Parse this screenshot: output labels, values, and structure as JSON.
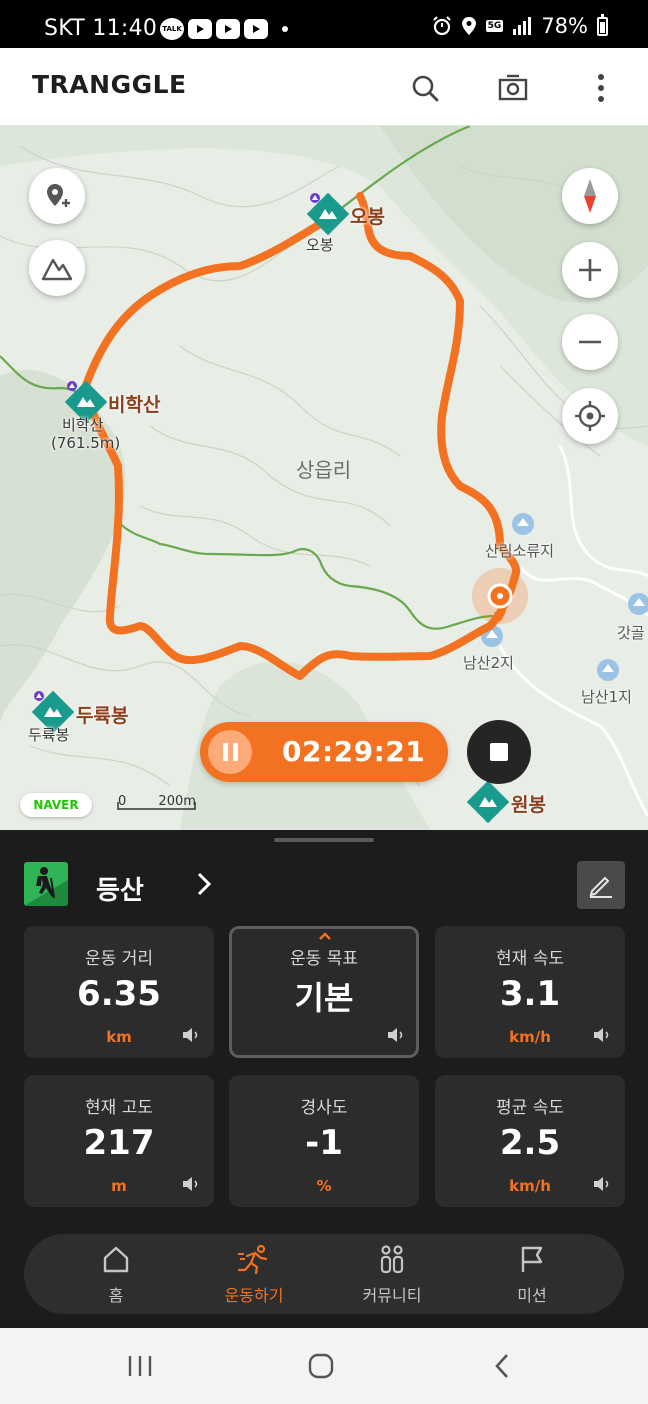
{
  "status_bar": {
    "carrier_time": "SKT 11:40",
    "talk_badge": "TALK",
    "network": "5G",
    "battery": "78%"
  },
  "app": {
    "logo": "TRANGGLE",
    "icons": [
      "search-icon",
      "camera-icon",
      "more-vertical-icon"
    ]
  },
  "map": {
    "peaks": [
      {
        "name": "오봉",
        "sub": "오봉"
      },
      {
        "name": "비학산",
        "sub_line1": "비학산",
        "sub_line2": "(761.5m)"
      },
      {
        "name": "두륙봉",
        "sub": "두륙봉"
      },
      {
        "name": "원봉"
      }
    ],
    "area_label": "상읍리",
    "places": [
      "산림소류지",
      "남산2지",
      "남산1지",
      "갓골"
    ],
    "attribution": "NAVER",
    "scale_zero": "0",
    "scale_distance": "200m",
    "controls": [
      "add-location-icon",
      "mountain-icon",
      "compass-icon",
      "zoom-in-icon",
      "zoom-out-icon",
      "my-location-icon"
    ]
  },
  "recording": {
    "elapsed": "02:29:21"
  },
  "activity": {
    "type": "등산"
  },
  "stats": [
    {
      "label": "운동 거리",
      "value": "6.35",
      "unit": "km"
    },
    {
      "label": "운동 목표",
      "value": "기본",
      "unit": ""
    },
    {
      "label": "현재 속도",
      "value": "3.1",
      "unit": "km/h"
    },
    {
      "label": "현재 고도",
      "value": "217",
      "unit": "m"
    },
    {
      "label": "경사도",
      "value": "-1",
      "unit": "%"
    },
    {
      "label": "평균 속도",
      "value": "2.5",
      "unit": "km/h"
    }
  ],
  "nav": [
    {
      "label": "홈",
      "icon": "home-icon"
    },
    {
      "label": "운동하기",
      "icon": "running-icon",
      "active": true
    },
    {
      "label": "커뮤니티",
      "icon": "community-icon"
    },
    {
      "label": "미션",
      "icon": "flag-icon"
    }
  ],
  "colors": {
    "accent": "#f37221",
    "panel_bg": "#1c1c1c",
    "card_bg": "#2c2c2c",
    "peak_marker": "#1a9a8c",
    "trail_green": "#6aa84f"
  }
}
